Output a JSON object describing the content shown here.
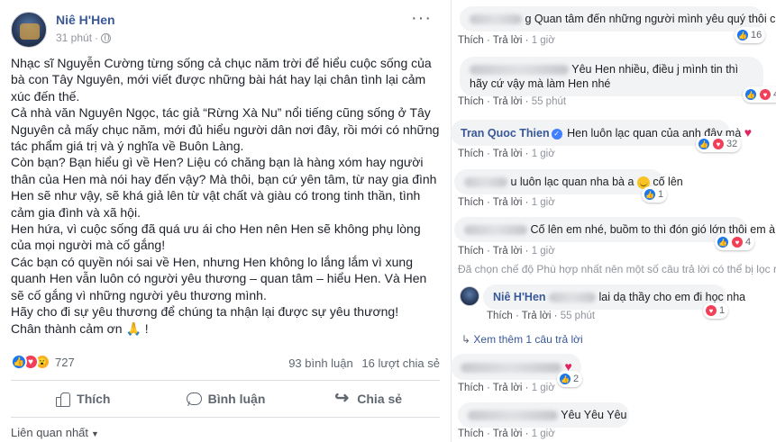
{
  "post": {
    "author": "Niê H'Hen",
    "time": "31 phút",
    "paragraphs": [
      "Nhạc sĩ Nguyễn Cường từng sống cả chục năm trời để hiểu cuộc sống của bà con Tây Nguyên, mới viết được những bài hát hay lại chân tình lại cảm xúc đến thế.",
      "Cả nhà văn Nguyên Ngọc, tác giả “Rừng Xà Nu” nổi tiếng cũng sống ở Tây Nguyên cả mấy chục năm, mới đủ hiểu người dân nơi đây, rồi mới có những tác phẩm giá trị và ý nghĩa về Buôn Làng.",
      "Còn bạn? Bạn hiểu gì về Hen? Liệu có chăng bạn là hàng xóm hay người thân của Hen mà nói hay đến vậy? Mà thôi, bạn cứ yên tâm, từ nay gia đình Hen sẽ như vậy, sẽ khá giả lên từ vật chất và giàu có trong tinh thần, tình cảm gia đình và xã hội.",
      "Hen hứa, vì cuộc sống đã quá ưu ái cho Hen nên Hen sẽ không phụ lòng của mọi người mà cố gắng!",
      "Các bạn có quyền nói sai về Hen, nhưng Hen không lo lắng lắm vì xung quanh Hen vẫn luôn có người yêu thương – quan tâm – hiểu Hen. Và Hen sẽ cố gắng vì những người yêu thương mình.",
      "Hãy cho đi sự yêu thương để chúng ta nhận lại được sự yêu thương!",
      "Chân thành cảm ơn 🙏 !"
    ],
    "reaction_count": "727",
    "comments_count": "93 bình luận",
    "shares_count": "16 lượt chia sẻ",
    "actions": {
      "like": "Thích",
      "comment": "Bình luận",
      "share": "Chia sẻ"
    },
    "sort_label": "Liên quan nhất"
  },
  "comments": {
    "like": "Thích",
    "reply": "Trả lời",
    "c1": {
      "text": "g Quan tâm đến những người mình yêu quý thôi c a",
      "time": "1 giờ",
      "reacts": "16"
    },
    "c2": {
      "text": "Yêu Hen nhiều, điều j mình tin thì hãy cứ vậy mà làm Hen nhé",
      "time": "55 phút",
      "reacts": "4"
    },
    "c3": {
      "name": "Tran Quoc Thien",
      "text": "Hen luôn lạc quan của anh đây mà",
      "time": "1 giờ",
      "reacts": "32"
    },
    "c4": {
      "text": "u luôn lạc quan nha bà a",
      "text2": "cố lên",
      "time": "1 giờ",
      "reacts": "1"
    },
    "c5": {
      "text": "Cố lên em nhé, buồm to thì đón gió lớn thôi em à",
      "time": "1 giờ",
      "reacts": "4"
    },
    "filter_note": "Đã chọn chế độ Phù hợp nhất nên một số câu trả lời có thể bị lọc ra.",
    "c6": {
      "name": "Niê H'Hen",
      "text": "lai dạ thầy cho em đi học nha",
      "time": "55 phút",
      "reacts": "1"
    },
    "more_replies": "Xem thêm 1 câu trả lời",
    "c7": {
      "time": "1 giờ",
      "reacts": "2"
    },
    "c8": {
      "text": "Yêu Yêu Yêu",
      "time": "1 giờ"
    }
  }
}
